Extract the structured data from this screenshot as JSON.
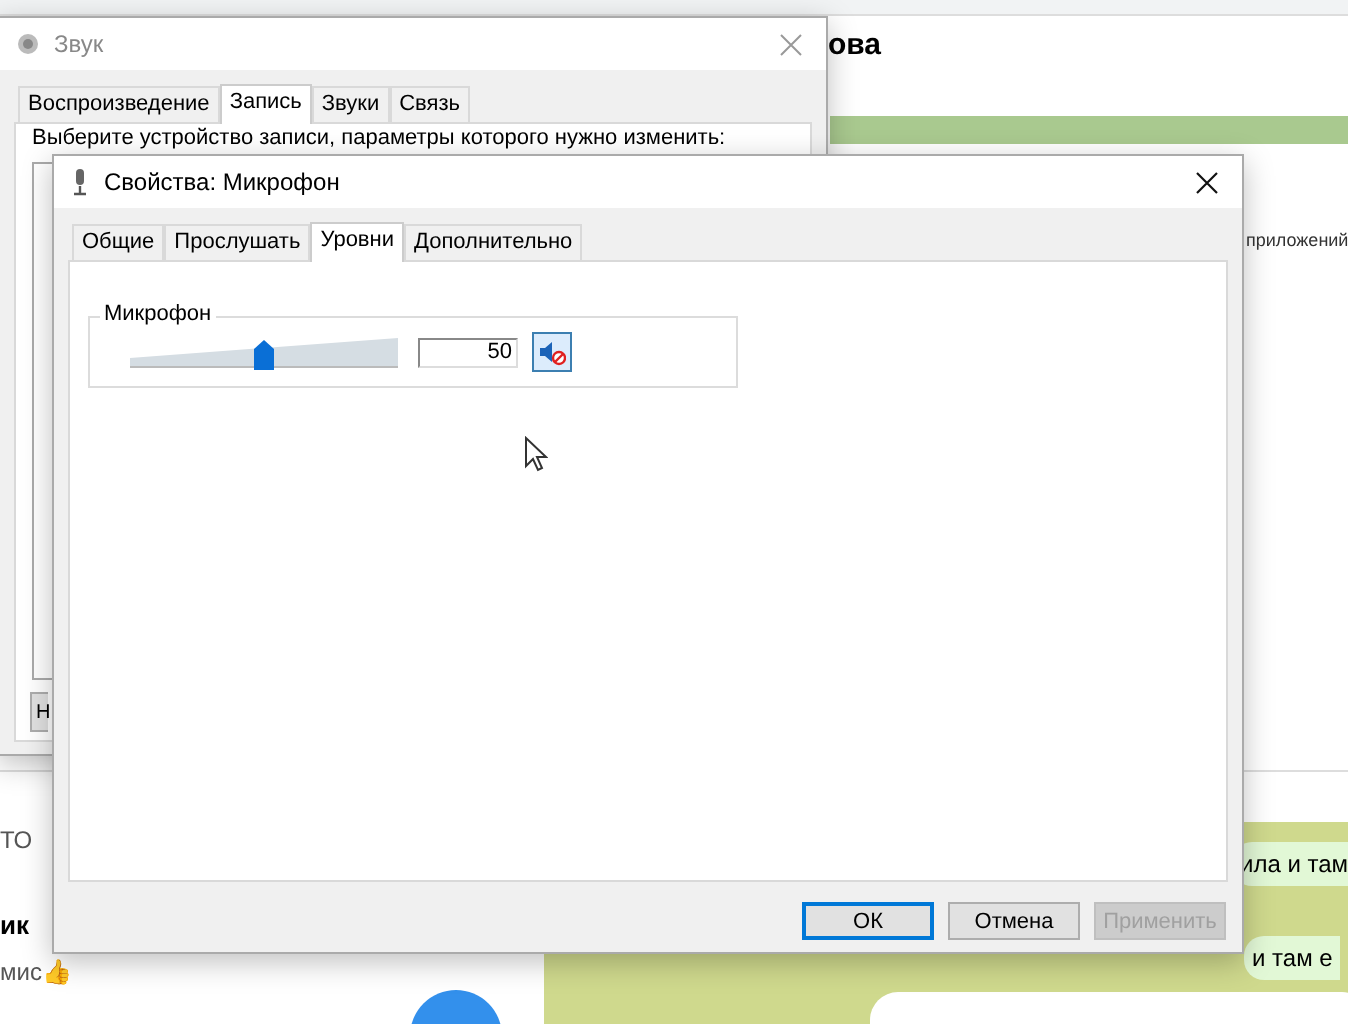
{
  "background": {
    "heading": "ова",
    "side_text": "приложений",
    "left_texts": [
      "ТО",
      "ик",
      "мис👍"
    ],
    "bubbles": [
      "ила и там",
      "и там е"
    ]
  },
  "sound_window": {
    "title": "Звук",
    "tabs": [
      {
        "label": "Воспроизведение",
        "selected": false
      },
      {
        "label": "Запись",
        "selected": true
      },
      {
        "label": "Звуки",
        "selected": false
      },
      {
        "label": "Связь",
        "selected": false
      }
    ],
    "instruction": "Выберите устройство записи, параметры которого нужно изменить:",
    "button_partial": "Н"
  },
  "properties_window": {
    "title": "Свойства: Микрофон",
    "tabs": [
      {
        "label": "Общие",
        "selected": false
      },
      {
        "label": "Прослушать",
        "selected": false
      },
      {
        "label": "Уровни",
        "selected": true
      },
      {
        "label": "Дополнительно",
        "selected": false
      }
    ],
    "group": {
      "label": "Микрофон",
      "level": 0.5,
      "value": "50",
      "muted": true
    },
    "buttons": [
      {
        "label": "ОК",
        "disabled": false,
        "default": true
      },
      {
        "label": "Отмена",
        "disabled": false,
        "default": false
      },
      {
        "label": "Применить",
        "disabled": true,
        "default": false
      }
    ]
  }
}
